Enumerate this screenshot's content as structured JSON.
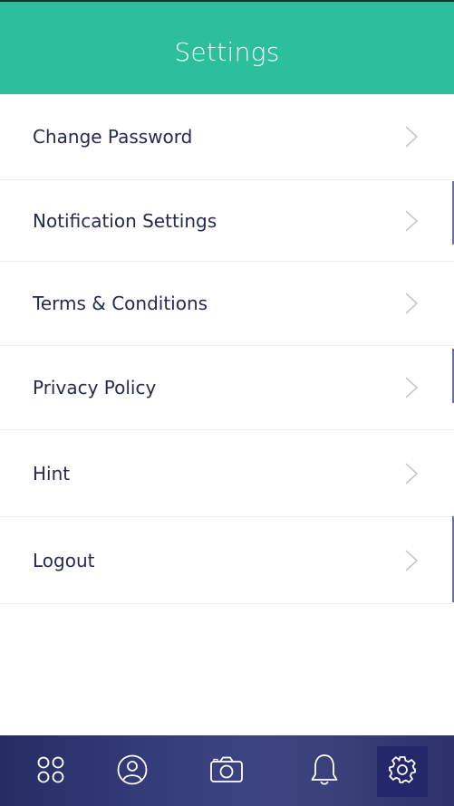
{
  "header": {
    "title": "Settings"
  },
  "settings": {
    "items": [
      {
        "label": "Change Password"
      },
      {
        "label": "Notification Settings"
      },
      {
        "label": "Terms & Conditions"
      },
      {
        "label": "Privacy Policy"
      },
      {
        "label": "Hint"
      },
      {
        "label": "Logout"
      }
    ]
  },
  "tabbar": {
    "tabs": [
      {
        "icon": "grid-icon",
        "active": false
      },
      {
        "icon": "profile-icon",
        "active": false
      },
      {
        "icon": "camera-icon",
        "active": false
      },
      {
        "icon": "bell-icon",
        "active": false
      },
      {
        "icon": "gear-icon",
        "active": true
      }
    ]
  },
  "colors": {
    "header": "#2cbf9b",
    "text": "#252a52",
    "chevron": "#c8c8c8",
    "tabbar": "#2f3570",
    "active_tab": "#24286a"
  }
}
